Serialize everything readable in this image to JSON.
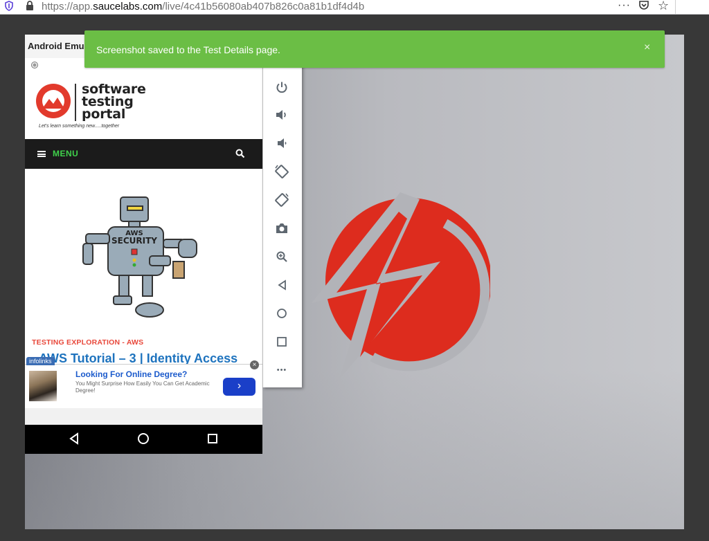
{
  "browser": {
    "url_prefix": "https://app.",
    "url_host": "saucelabs.com",
    "url_path": "/live/4c41b56080ab407b826c0a81b1df4d4b",
    "more_icon": "···"
  },
  "toast": {
    "message": "Screenshot saved to the Test Details page.",
    "close_label": "×",
    "color": "#6bbe45"
  },
  "emulator": {
    "title": "Android Emulator",
    "toolbar_buttons": [
      "power-icon",
      "volume-up-icon",
      "volume-down-icon",
      "rotate-left-icon",
      "rotate-right-icon",
      "camera-icon",
      "zoom-icon",
      "back-icon",
      "home-icon",
      "overview-icon",
      "more-icon"
    ],
    "toolbar_more": "•••"
  },
  "site": {
    "brand_lines": [
      "software",
      "testing",
      "portal"
    ],
    "tagline": "Let's learn something new.....together",
    "menu_label": "MENU",
    "robot_text_1": "AWS",
    "robot_text_2": "SECURITY",
    "category": "TESTING EXPLORATION - AWS",
    "headline": "AWS Tutorial – 3 | Identity Access",
    "accent_red": "#e8473a",
    "link_blue": "#1e73be"
  },
  "ad": {
    "tab_label": "infolinks",
    "close_label": "×",
    "title": "Looking For Online Degree?",
    "description": "You Might Surprise How Easily You Can Get Academic Degree!",
    "button_label": "›"
  },
  "sauce": {
    "logo_red": "#dd2c1e"
  }
}
